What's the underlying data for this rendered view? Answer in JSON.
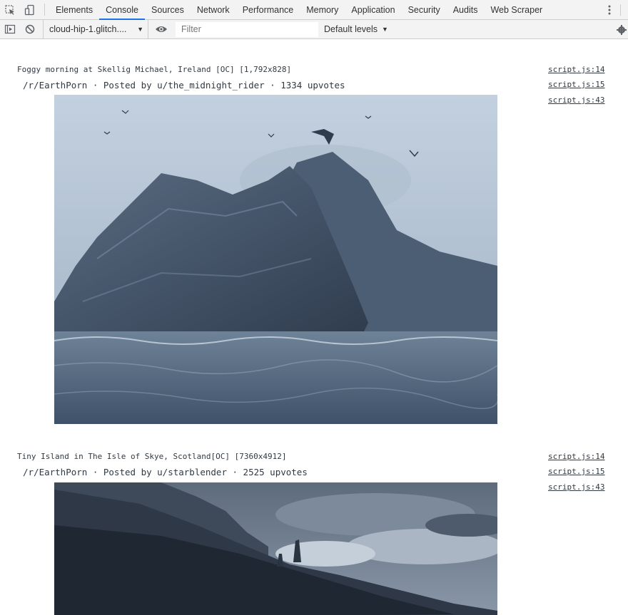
{
  "devtools": {
    "tabs": [
      {
        "label": "Elements"
      },
      {
        "label": "Console"
      },
      {
        "label": "Sources"
      },
      {
        "label": "Network"
      },
      {
        "label": "Performance"
      },
      {
        "label": "Memory"
      },
      {
        "label": "Application"
      },
      {
        "label": "Security"
      },
      {
        "label": "Audits"
      },
      {
        "label": "Web Scraper"
      }
    ],
    "active_tab": "Console"
  },
  "toolbar": {
    "context": "cloud-hip-1.glitch....",
    "filter_placeholder": "Filter",
    "filter_value": "",
    "levels": "Default levels"
  },
  "posts": [
    {
      "title": "Foggy morning at Skellig Michael, Ireland [OC] [1,792x828]",
      "meta": "/r/EarthPorn · Posted by u/the_midnight_rider · 1334 upvotes",
      "sources": [
        "script.js:14",
        "script.js:15",
        "script.js:43"
      ]
    },
    {
      "title": "Tiny Island in The Isle of Skye, Scotland[OC] [7360x4912]",
      "meta": "/r/EarthPorn · Posted by u/starblender · 2525 upvotes",
      "sources": [
        "script.js:14",
        "script.js:15",
        "script.js:43"
      ]
    }
  ],
  "colors": {
    "accent": "#1a73e8",
    "toolbar_bg": "#f3f3f3",
    "border": "#cbcdd1",
    "text": "#303942"
  }
}
